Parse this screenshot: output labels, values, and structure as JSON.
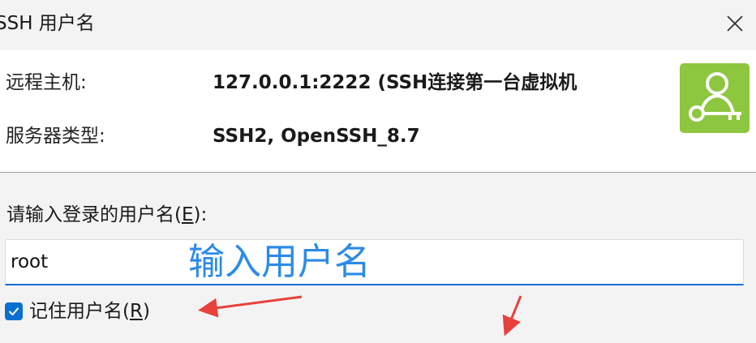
{
  "window": {
    "title": "SSH 用户名",
    "close_icon": "close-icon"
  },
  "info": {
    "host_label": "远程主机:",
    "host_value": "127.0.0.1:2222 (SSH连接第一台虚拟机",
    "server_type_label": "服务器类型:",
    "server_type_value": "SSH2, OpenSSH_8.7",
    "icon": "user-key-icon",
    "icon_color": "#8dc63f"
  },
  "form": {
    "prompt_text": "请输入登录的用户名(",
    "prompt_accel": "E",
    "prompt_suffix": "):",
    "username_value": "root",
    "remember_text": "记住用户名(",
    "remember_accel": "R",
    "remember_suffix": ")",
    "remember_checked": true
  },
  "annotations": {
    "input_hint": "输入用户名",
    "hint_color": "#2c8be8",
    "arrow_color": "#e8413b"
  },
  "colors": {
    "accent": "#0a6fd1",
    "background": "#f3f3f3",
    "panel": "#ffffff"
  }
}
